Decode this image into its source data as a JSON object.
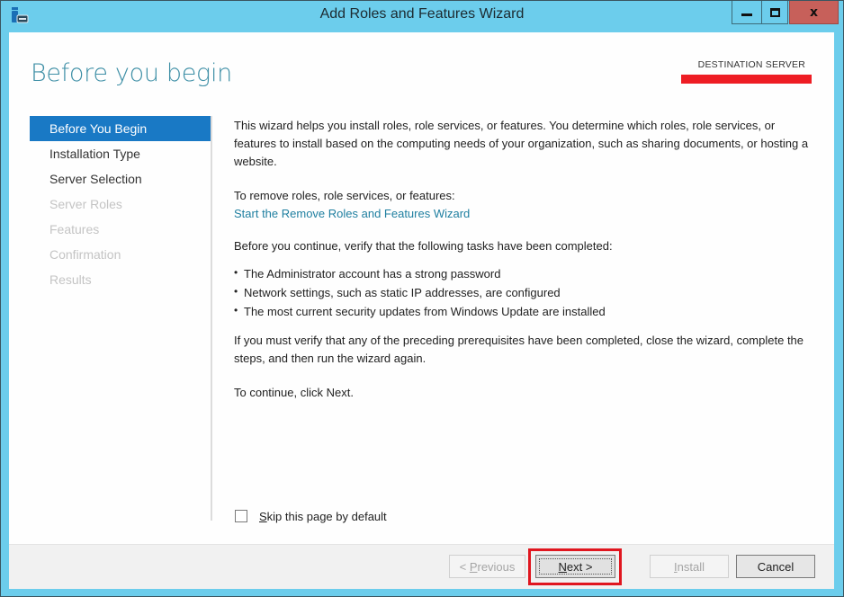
{
  "window": {
    "title": "Add Roles and Features Wizard",
    "icon": "server-manager-icon",
    "controls": {
      "minimize_icon": "minimize-icon",
      "maximize_icon": "maximize-icon",
      "close_icon": "close-icon",
      "close_glyph": "x"
    }
  },
  "header": {
    "page_title": "Before you begin",
    "destination_label": "DESTINATION SERVER",
    "destination_value_redacted": true,
    "redaction_color": "#ee1d24"
  },
  "sidebar": {
    "items": [
      {
        "label": "Before You Begin",
        "state": "active"
      },
      {
        "label": "Installation Type",
        "state": "enabled"
      },
      {
        "label": "Server Selection",
        "state": "enabled"
      },
      {
        "label": "Server Roles",
        "state": "disabled"
      },
      {
        "label": "Features",
        "state": "disabled"
      },
      {
        "label": "Confirmation",
        "state": "disabled"
      },
      {
        "label": "Results",
        "state": "disabled"
      }
    ],
    "active_color": "#1979c5"
  },
  "content": {
    "intro": "This wizard helps you install roles, role services, or features. You determine which roles, role services, or features to install based on the computing needs of your organization, such as sharing documents, or hosting a website.",
    "remove_prompt": "To remove roles, role services, or features:",
    "remove_link": "Start the Remove Roles and Features Wizard",
    "verify_intro": "Before you continue, verify that the following tasks have been completed:",
    "prerequisites": [
      "The Administrator account has a strong password",
      "Network settings, such as static IP addresses, are configured",
      "The most current security updates from Windows Update are installed"
    ],
    "verify_note": "If you must verify that any of the preceding prerequisites have been completed, close the wizard, complete the steps, and then run the wizard again.",
    "continue_note": "To continue, click Next."
  },
  "skip": {
    "label_accel": "S",
    "label_rest": "kip this page by default",
    "checked": false
  },
  "footer": {
    "previous": {
      "prefix": "< ",
      "accel": "P",
      "rest": "revious",
      "enabled": false
    },
    "next": {
      "accel": "N",
      "rest": "ext >",
      "enabled": true,
      "focused": true,
      "highlighted": true
    },
    "install": {
      "accel": "I",
      "rest": "nstall",
      "enabled": false
    },
    "cancel": {
      "label": "Cancel",
      "enabled": true
    },
    "highlight_color": "#e0161f"
  }
}
